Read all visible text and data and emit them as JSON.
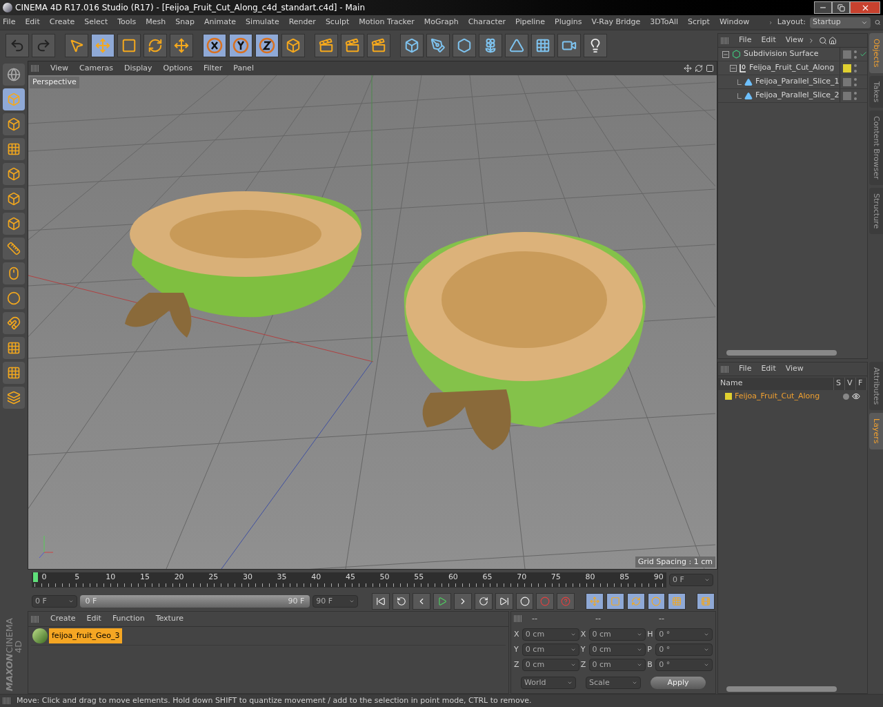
{
  "window": {
    "title": "CINEMA 4D R17.016 Studio (R17) - [Feijoa_Fruit_Cut_Along_c4d_standart.c4d] - Main"
  },
  "menu": [
    "File",
    "Edit",
    "Create",
    "Select",
    "Tools",
    "Mesh",
    "Snap",
    "Animate",
    "Simulate",
    "Render",
    "Sculpt",
    "Motion Tracker",
    "MoGraph",
    "Character",
    "Pipeline",
    "Plugins",
    "V-Ray Bridge",
    "3DToAll",
    "Script",
    "Window"
  ],
  "layout": {
    "label": "Layout:",
    "value": "Startup"
  },
  "toolbar": [
    {
      "selected": false
    },
    {
      "selected": false
    },
    {
      "selected": false
    },
    {
      "selected": true
    },
    {
      "selected": false
    },
    {
      "selected": false
    },
    {
      "selected": false
    },
    {
      "selected": true
    },
    {
      "selected": true
    },
    {
      "selected": true
    },
    {
      "selected": false
    },
    {
      "selected": false
    },
    {
      "selected": false
    },
    {
      "selected": false
    },
    {
      "selected": false
    },
    {
      "selected": false
    },
    {
      "selected": false
    },
    {
      "selected": false
    },
    {
      "selected": false
    },
    {
      "selected": false
    },
    {
      "selected": false
    }
  ],
  "left_tools": [
    {
      "selected": false
    },
    {
      "selected": true
    },
    {
      "selected": false
    },
    {
      "selected": false
    },
    {
      "selected": false
    },
    {
      "selected": false
    },
    {
      "selected": false
    },
    {
      "selected": false
    },
    {
      "selected": false
    },
    {
      "selected": false
    },
    {
      "selected": false
    },
    {
      "selected": false
    },
    {
      "selected": false
    },
    {
      "selected": false
    }
  ],
  "viewport": {
    "menu": [
      "View",
      "Cameras",
      "Display",
      "Options",
      "Filter",
      "Panel"
    ],
    "camera": "Perspective",
    "grid_spacing": "Grid Spacing : 1 cm"
  },
  "objects": {
    "menu": [
      "File",
      "Edit",
      "View"
    ],
    "tree": [
      {
        "name": "Subdivision Surface",
        "expanded": true,
        "children": [
          {
            "name": "Feijoa_Fruit_Cut_Along",
            "expanded": true,
            "color": "#e0d030",
            "children": [
              {
                "name": "Feijoa_Parallel_Slice_1"
              },
              {
                "name": "Feijoa_Parallel_Slice_2"
              }
            ]
          }
        ]
      }
    ]
  },
  "side_tabs_top": [
    {
      "label": "Objects",
      "selected": true
    },
    {
      "label": "Takes",
      "selected": false
    },
    {
      "label": "Content Browser",
      "selected": false
    },
    {
      "label": "Structure",
      "selected": false
    }
  ],
  "layers": {
    "menu": [
      "File",
      "Edit",
      "View"
    ],
    "columns": [
      "Name",
      "S",
      "V",
      "F"
    ],
    "rows": [
      {
        "name": "Feijoa_Fruit_Cut_Along",
        "color": "#e0d030"
      }
    ]
  },
  "side_tabs_bottom": [
    {
      "label": "Attributes",
      "selected": false
    },
    {
      "label": "Layers",
      "selected": true
    }
  ],
  "timeline": {
    "ruler": [
      "0",
      "5",
      "10",
      "15",
      "20",
      "25",
      "30",
      "35",
      "40",
      "45",
      "50",
      "55",
      "60",
      "65",
      "70",
      "75",
      "80",
      "85",
      "90"
    ],
    "level": 0,
    "current": "0 F",
    "start": "0 F",
    "range": {
      "level": 1
    },
    "range_start": "0 F",
    "range_end": "90 F",
    "end": "90 F"
  },
  "materials": {
    "menu": [
      "Create",
      "Edit",
      "Function",
      "Texture"
    ],
    "items": [
      {
        "name": "feijoa_fruit_Geo_3",
        "selected": true
      }
    ]
  },
  "coordinates": {
    "headers": [
      "--",
      "--",
      "--"
    ],
    "rows": [
      {
        "a": "X",
        "v1": "0 cm",
        "b": "X",
        "v2": "0 cm",
        "c": "H",
        "v3": "0 °"
      },
      {
        "a": "Y",
        "v1": "0 cm",
        "b": "Y",
        "v2": "0 cm",
        "c": "P",
        "v3": "0 °"
      },
      {
        "a": "Z",
        "v1": "0 cm",
        "b": "Z",
        "v2": "0 cm",
        "c": "B",
        "v3": "0 °"
      }
    ],
    "mode": "World",
    "size_mode": "Scale",
    "apply": "Apply"
  },
  "brand": {
    "line1": "MAXON",
    "line2": "CINEMA 4D"
  },
  "status": "Move: Click and drag to move elements. Hold down SHIFT to quantize movement / add to the selection in point mode, CTRL to remove."
}
